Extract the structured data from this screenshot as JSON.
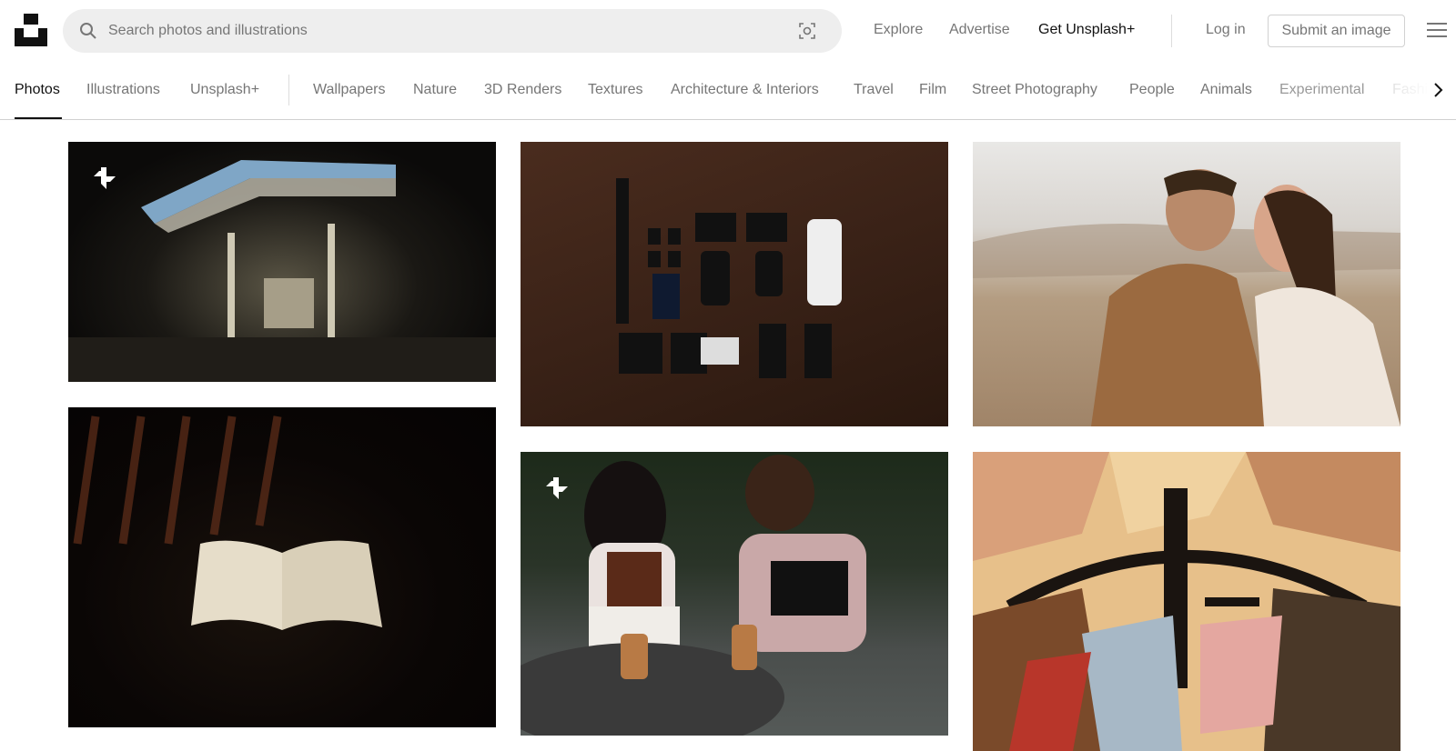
{
  "header": {
    "logo": "unsplash-logo",
    "search_placeholder": "Search photos and illustrations",
    "nav": [
      "Explore",
      "Advertise",
      "Get Unsplash+"
    ],
    "login": "Log in",
    "submit": "Submit an image"
  },
  "tabs": {
    "primary": [
      "Photos",
      "Illustrations",
      "Unsplash+"
    ],
    "topics": [
      "Wallpapers",
      "Nature",
      "3D Renders",
      "Textures",
      "Architecture & Interiors",
      "Travel",
      "Film",
      "Street Photography",
      "People",
      "Animals",
      "Experimental",
      "Fashion"
    ],
    "active": "Photos"
  },
  "photos": [
    {
      "subject": "Gas station at night",
      "plus": true
    },
    {
      "subject": "Open book in dark",
      "plus": false
    },
    {
      "subject": "Camera gear flat lay on wood",
      "plus": false
    },
    {
      "subject": "Two women reading at cafe table",
      "plus": true
    },
    {
      "subject": "Couple embracing in field",
      "plus": false
    },
    {
      "subject": "Abstract cubist painting",
      "plus": false
    }
  ]
}
